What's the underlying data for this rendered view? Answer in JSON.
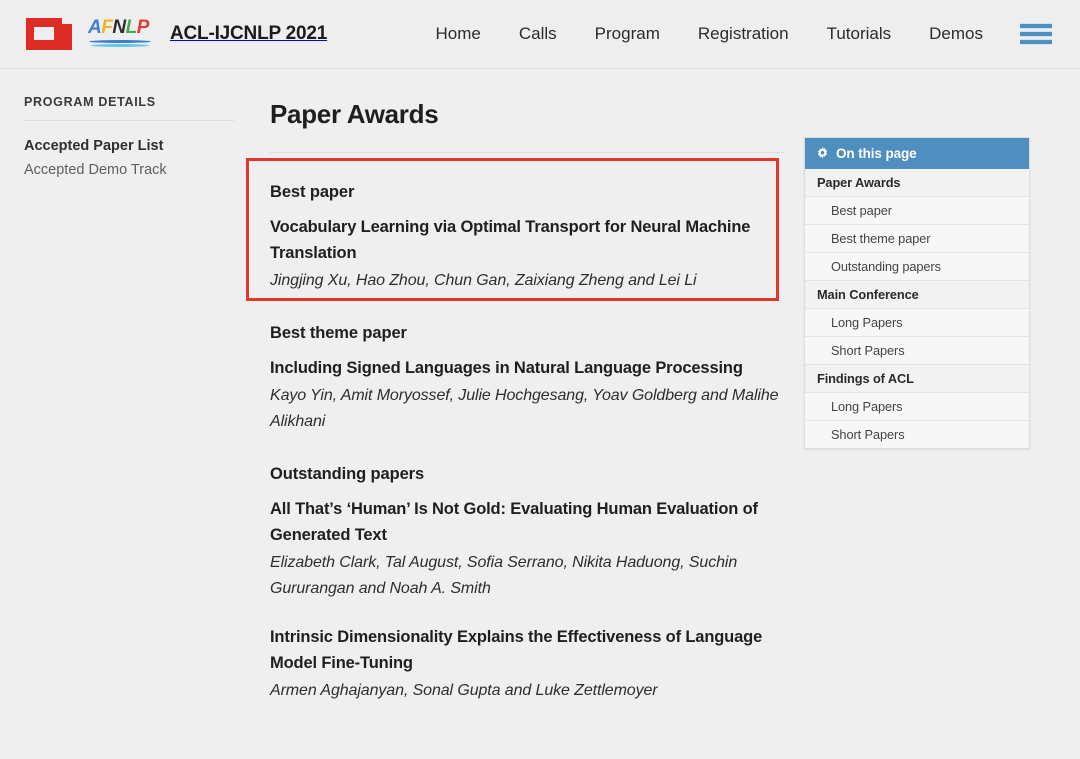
{
  "header": {
    "brand_title": "ACL-IJCNLP 2021",
    "logo_acl": "acl-logo",
    "logo_afnlp_letters": [
      "A",
      "F",
      "N",
      "L",
      "P"
    ],
    "menu_icon": "hamburger-menu-icon",
    "nav": [
      {
        "label": "Home"
      },
      {
        "label": "Calls"
      },
      {
        "label": "Program"
      },
      {
        "label": "Registration"
      },
      {
        "label": "Tutorials"
      },
      {
        "label": "Demos"
      }
    ]
  },
  "sidebar": {
    "title": "PROGRAM DETAILS",
    "items": [
      {
        "label": "Accepted Paper List",
        "active": true
      },
      {
        "label": "Accepted Demo Track",
        "active": false
      }
    ]
  },
  "main": {
    "page_title": "Paper Awards",
    "groups": [
      {
        "kicker": "Best paper",
        "papers": [
          {
            "title": "Vocabulary Learning via Optimal Transport for Neural Machine Translation",
            "authors": "Jingjing Xu, Hao Zhou, Chun Gan, Zaixiang Zheng and Lei Li"
          }
        ]
      },
      {
        "kicker": "Best theme paper",
        "papers": [
          {
            "title": "Including Signed Languages in Natural Language Processing",
            "authors": "Kayo Yin, Amit Moryossef, Julie Hochgesang, Yoav Goldberg and Malihe Alikhani"
          }
        ]
      },
      {
        "kicker": "Outstanding papers",
        "papers": [
          {
            "title": "All That’s ‘Human’ Is Not Gold: Evaluating Human Evaluation of Generated Text",
            "authors": "Elizabeth Clark, Tal August, Sofia Serrano, Nikita Haduong, Suchin Gururangan and Noah A. Smith"
          },
          {
            "title": "Intrinsic Dimensionality Explains the Effectiveness of Language Model Fine-Tuning",
            "authors": "Armen Aghajanyan, Sonal Gupta and Luke Zettlemoyer"
          }
        ]
      }
    ]
  },
  "toc": {
    "header_label": "On this page",
    "header_icon": "gear-icon",
    "rows": [
      {
        "label": "Paper Awards",
        "type": "section"
      },
      {
        "label": "Best paper",
        "type": "sub"
      },
      {
        "label": "Best theme paper",
        "type": "sub"
      },
      {
        "label": "Outstanding papers",
        "type": "sub"
      },
      {
        "label": "Main Conference",
        "type": "section"
      },
      {
        "label": "Long Papers",
        "type": "sub"
      },
      {
        "label": "Short Papers",
        "type": "sub"
      },
      {
        "label": "Findings of ACL",
        "type": "section"
      },
      {
        "label": "Long Papers",
        "type": "sub"
      },
      {
        "label": "Short Papers",
        "type": "sub"
      }
    ]
  },
  "annotation": {
    "name": "best-paper-highlight",
    "color": "#df392c"
  }
}
